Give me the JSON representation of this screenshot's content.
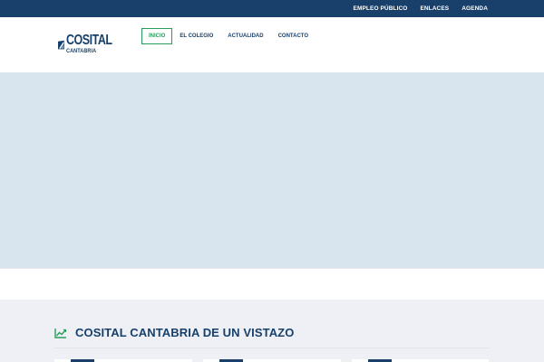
{
  "topbar": {
    "links": [
      {
        "label": "EMPLEO PÚBLICO"
      },
      {
        "label": "ENLACES"
      },
      {
        "label": "AGENDA"
      }
    ]
  },
  "logo": {
    "main": "COSITAL",
    "sub": "CANTABRIA"
  },
  "nav": {
    "items": [
      {
        "label": "INICIO",
        "active": true
      },
      {
        "label": "EL COLEGIO"
      },
      {
        "label": "ACTUALIDAD"
      },
      {
        "label": "CONTACTO"
      }
    ]
  },
  "section": {
    "title": "COSITAL CANTABRIA DE UN VISTAZO",
    "icon": "chart-line-icon"
  },
  "colors": {
    "brand": "#18406b",
    "accent": "#2a9d5c",
    "hero_bg": "#d8e4ee",
    "section_bg": "#eef0f5"
  }
}
